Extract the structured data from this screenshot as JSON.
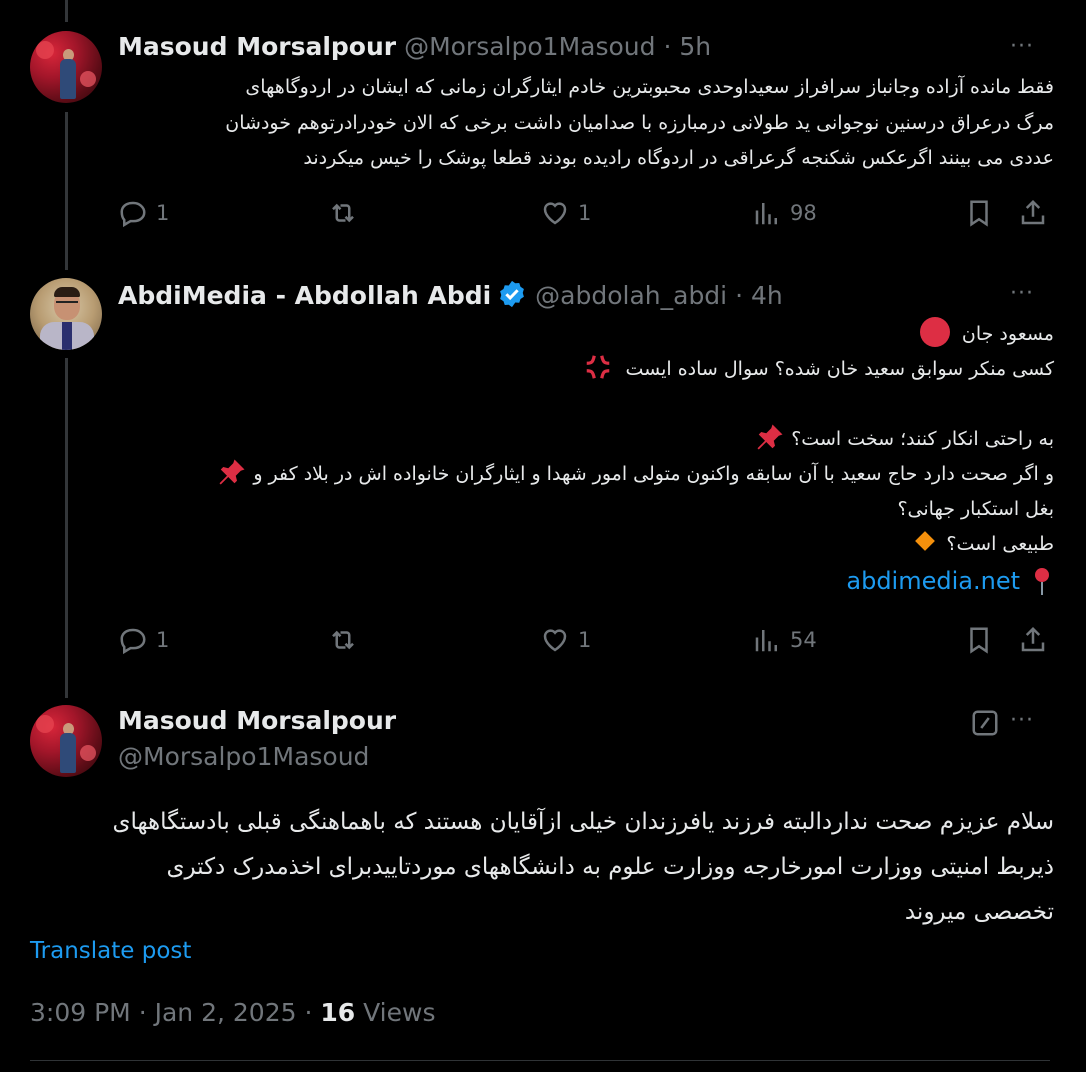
{
  "tweet1": {
    "name": "Masoud Morsalpour",
    "handle": "@Morsalpo1Masoud",
    "time": "5h",
    "lines": [
      "فقط مانده آزاده وجانباز سرافراز سعیداوحدی محبوبترین خادم ایثارگران زمانی که ایشان در اردوگاههای",
      "مرگ درعراق درسنین نوجوانی ید طولانی درمبارزه با صدامیان داشت برخی که الان خودرادرتوهم خودشان",
      "عددی می بینند اگرعکس  شکنجه گرعراقی در اردوگاه رادیده بودند قطعا پوشک را خیس میکردند"
    ],
    "replies": "1",
    "reposts": "",
    "likes": "1",
    "views": "98"
  },
  "tweet2": {
    "name": "AbdiMedia - Abdollah Abdi",
    "handle": "@abdolah_abdi",
    "time": "4h",
    "lines": [
      "مسعود جان",
      "کسی منکر سوابق سعید خان شده؟ سوال ساده ایست",
      "",
      "به راحتی انکار کنند؛ سخت است؟",
      "و اگر صحت دارد حاج سعید با آن سابقه واکنون متولی امور شهدا و ایثارگران خانواده اش در بلاد کفر و",
      "بغل استکبار جهانی؟",
      "طبیعی است؟"
    ],
    "link": "abdimedia.net",
    "replies": "1",
    "reposts": "",
    "likes": "1",
    "views": "54"
  },
  "main": {
    "name": "Masoud Morsalpour",
    "handle": "@Morsalpo1Masoud",
    "lines": [
      "سلام عزیزم صحت نداردالبته فرزند یافرزندان خیلی ازآقایان هستند که باهماهنگی قبلی بادستگاههای",
      "ذیربط امنیتی ووزارت امورخارجه ووزارت علوم به دانشگاههای موردتاییدبرای اخذمدرک دکتری",
      "تخصصی میروند"
    ],
    "translate": "Translate post",
    "time": "3:09 PM",
    "date": "Jan 2, 2025",
    "views_count": "16",
    "views_label": "Views"
  },
  "ui": {
    "more": "···",
    "dot": "·",
    "accent": "#1d9bf0"
  },
  "icons": [
    "reply-icon",
    "repost-icon",
    "like-icon",
    "views-icon",
    "bookmark-icon",
    "share-icon",
    "verified-icon",
    "edit-icon",
    "more-icon"
  ]
}
